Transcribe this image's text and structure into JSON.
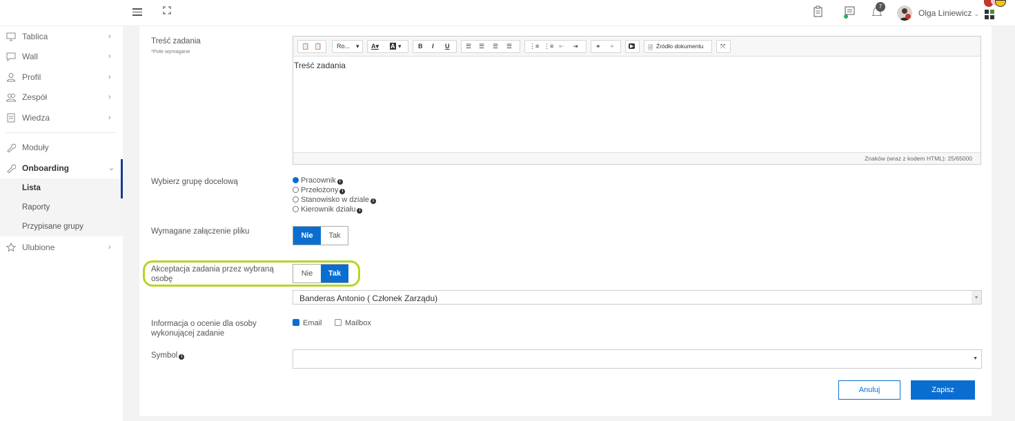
{
  "header": {
    "user_name": "Olga Liniewicz",
    "notification_count": "7",
    "icons": [
      "hamburger-icon",
      "fullscreen-icon",
      "clipboard-icon",
      "chat-icon",
      "bell-icon",
      "apps-grid-icon"
    ]
  },
  "sidebar": {
    "items": [
      {
        "label": "Tablica",
        "icon": "monitor-icon"
      },
      {
        "label": "Wall",
        "icon": "chat-bubble-icon"
      },
      {
        "label": "Profil",
        "icon": "user-icon"
      },
      {
        "label": "Zespół",
        "icon": "team-icon"
      },
      {
        "label": "Wiedza",
        "icon": "book-icon"
      },
      {
        "label": "Moduły",
        "icon": "wrench-icon"
      },
      {
        "label": "Onboarding",
        "icon": "wrench-icon"
      },
      {
        "label": "Ulubione",
        "icon": "star-icon"
      }
    ],
    "subitems": [
      "Lista",
      "Raporty",
      "Przypisane grupy"
    ],
    "active_sub": "Lista"
  },
  "form": {
    "task_content": {
      "label": "Treść zadania",
      "required_note": "*Pole wymagane",
      "value": "Treść zadania",
      "toolbar": {
        "font": "Ro...",
        "source": "Źródło dokumentu"
      },
      "char_count": "Znaków (wraz z kodem HTML): 25/65000"
    },
    "target_group": {
      "label": "Wybierz grupę docelową",
      "options": [
        "Pracownik",
        "Przełożony",
        "Stanowisko w dziale",
        "Kierownik działu"
      ],
      "selected": "Pracownik"
    },
    "file_required": {
      "label": "Wymagane załączenie pliku",
      "no": "Nie",
      "yes": "Tak",
      "selected": "Nie"
    },
    "acceptance": {
      "label": "Akceptacja zadania przez wybraną osobę",
      "no": "Nie",
      "yes": "Tak",
      "selected": "Tak",
      "person": "Banderas Antonio ( Członek Zarządu)"
    },
    "rating_info": {
      "label": "Informacja o ocenie dla osoby wykonującej zadanie",
      "email": "Email",
      "mailbox": "Mailbox",
      "email_checked": true,
      "mailbox_checked": false
    },
    "symbol": {
      "label": "Symbol",
      "value": ""
    }
  },
  "buttons": {
    "cancel": "Anuluj",
    "save": "Zapisz"
  },
  "colors": {
    "accent": "#0a6ed1",
    "highlight": "#b8d424",
    "active_bar": "#1a3a8c"
  }
}
